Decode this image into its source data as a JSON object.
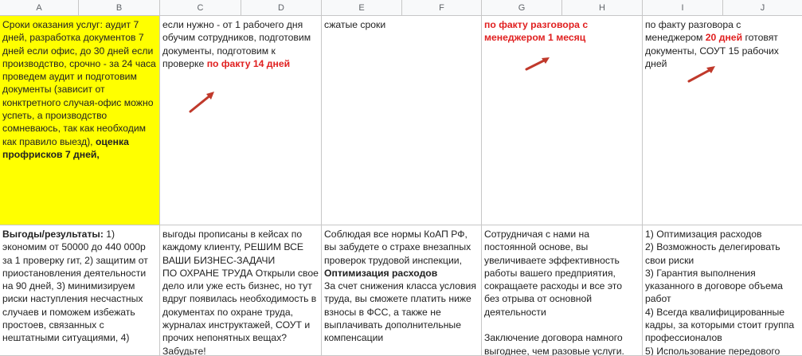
{
  "columns": [
    "A",
    "B",
    "C",
    "D",
    "E",
    "F",
    "G",
    "H",
    "I",
    "J"
  ],
  "accent": {
    "highlight_yellow": "#ffff00",
    "red_text": "#e02020",
    "arrow_color": "#c0392b"
  },
  "row1": {
    "a_text_1": "Сроки оказания услуг: аудит 7 дней, разработка документов 7 дней если офис, до 30 дней если производство, срочно - за 24 часа проведем аудит и подготовим документы (зависит от конктретного случая-офис можно успеть, а производство сомневаюсь, так как необходим как правило выезд), ",
    "a_text_bold": "оценка профрисков 7 дней,",
    "c_text_1": "если нужно - от 1 рабочего дня обучим сотрудников, подготовим документы, подготовим к проверке ",
    "c_text_red": "по факту 14 дней",
    "e_text": "сжатые сроки",
    "g_text_red": "по факту разговора с менеджером 1 месяц",
    "i_text_1": "по факту разговора с менеджером ",
    "i_text_red": "20 дней",
    "i_text_2": " готовят документы, СОУТ 15 рабочих дней"
  },
  "row2": {
    "a_text_bold": "Выгоды/результаты: ",
    "a_text": "1) экономим от 50000 до 440 000р за 1 проверку гит, 2) защитим от приостановления деятельности на 90 дней, 3) минимизируем риски наступления несчастных случаев и поможем избежать простоев, связанных с нештатными ситуациями, 4)",
    "c_text": "выгоды прописаны в кейсах по каждому клиенту, РЕШИМ ВСЕ ВАШИ БИЗНЕС-ЗАДАЧИ\nПО ОХРАНЕ ТРУДА Открыли свое дело или уже есть бизнес, но тут вдруг появилась необходимость в документах по охране труда, журналах инструктажей, СОУТ и прочих непонятных вещах? Забудьте!",
    "e_text_1": "Соблюдая все нормы КоАП РФ, вы забудете о страхе внезапных проверок трудовой инспекции, ",
    "e_text_bold": "Оптимизация расходов",
    "e_text_2": "\nЗа счет снижения класса условия труда, вы сможете платить ниже взносы в ФСС, а также не выплачивать дополнительные компенсации",
    "g_text": "Сотрудничая с нами на постоянной основе, вы увеличиваете эффективность работы вашего предприятия, сокращаете расходы и все это без отрыва от основной деятельности\n\nЗаключение договора намного выгоднее, чем разовые услуги.",
    "i_text": "1) Оптимизация расходов\n2) Возможность делегировать свои риски\n3) Гарантия выполнения указанного в договоре объема работ\n4) Всегда квалифицированные кадры, за которыми стоит группа профессионалов\n5) Использование передового"
  }
}
